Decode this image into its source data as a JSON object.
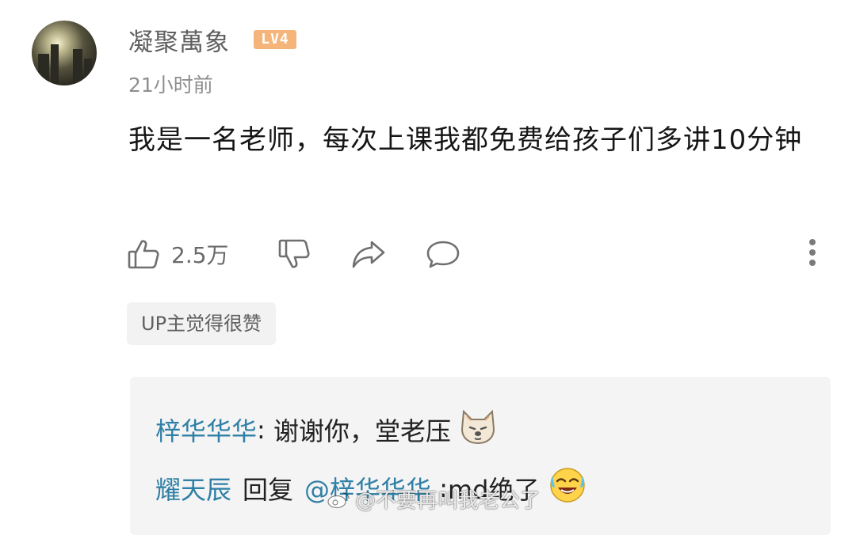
{
  "comment": {
    "username": "凝聚萬象",
    "level": "LV4",
    "time": "21小时前",
    "content": "我是一名老师，每次上课我都免费给孩子们多讲10分钟",
    "like_count": "2.5万",
    "up_tag": "UP主觉得很赞"
  },
  "replies": [
    {
      "name": "梓华华华",
      "separator": ": ",
      "text": "谢谢你，堂老压",
      "emoji": "dog-face-emoji"
    },
    {
      "name": "耀天辰",
      "action": "回复",
      "mention": "@梓华华华",
      "separator": " :",
      "text": "md绝了",
      "emoji": "laughing-crying-emoji"
    }
  ],
  "watermark": "@不要再叫我老公了",
  "icons": [
    "thumbs-up-icon",
    "thumbs-down-icon",
    "share-icon",
    "reply-bubble-icon",
    "more-vertical-icon",
    "weibo-logo-icon"
  ],
  "colors": {
    "username": "#5f5f5f",
    "level_badge": "#f5b47a",
    "reply_name": "#2f7fa6",
    "reply_box_bg": "#f4f4f4"
  }
}
